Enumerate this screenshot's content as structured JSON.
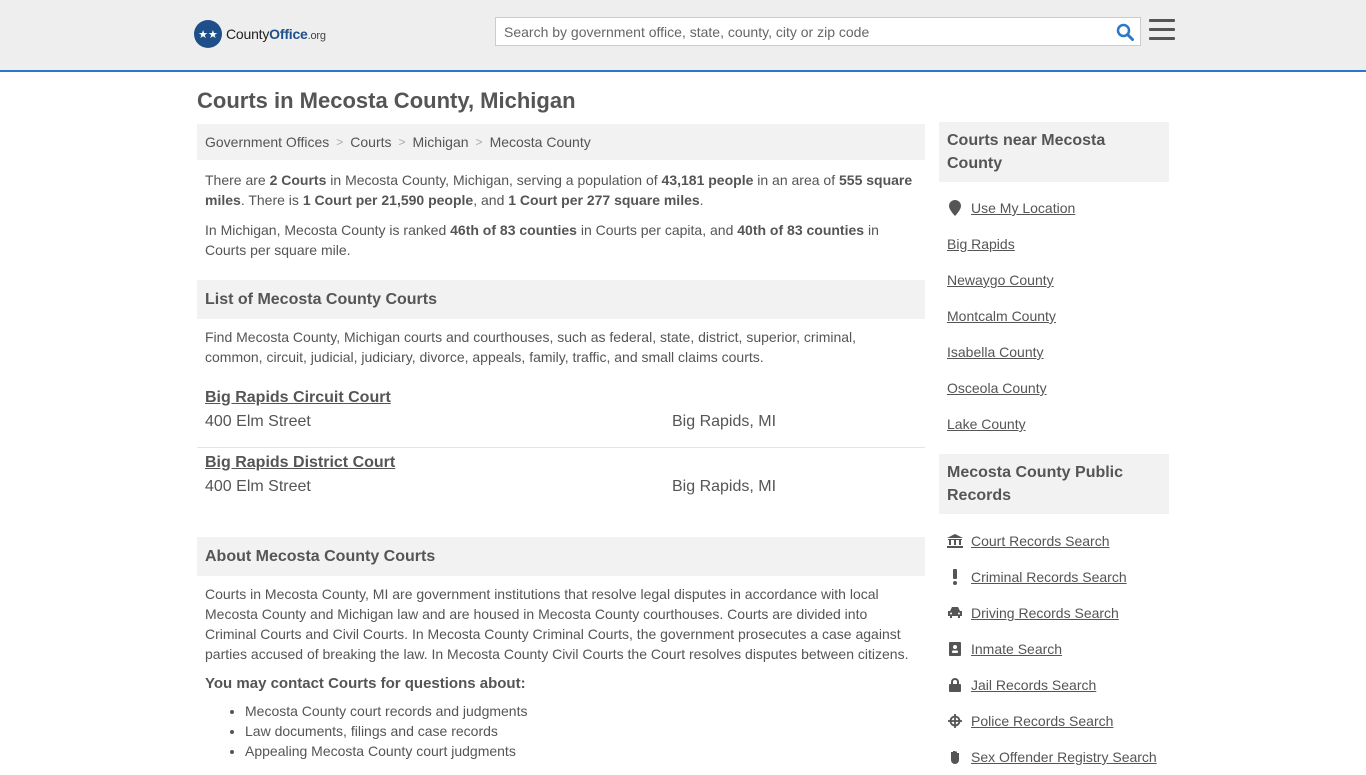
{
  "header": {
    "logo_main": "County",
    "logo_bold": "Office",
    "logo_org": ".org",
    "search_placeholder": "Search by government office, state, county, city or zip code"
  },
  "page_title": "Courts in Mecosta County, Michigan",
  "breadcrumb": [
    "Government Offices",
    "Courts",
    "Michigan",
    "Mecosta County"
  ],
  "intro": {
    "p1": {
      "t1": "There are ",
      "b1": "2 Courts",
      "t2": " in Mecosta County, Michigan, serving a population of ",
      "b2": "43,181 people",
      "t3": " in an area of ",
      "b3": "555 square miles",
      "t4": ". There is ",
      "b4": "1 Court per 21,590 people",
      "t5": ", and ",
      "b5": "1 Court per 277 square miles",
      "t6": "."
    },
    "p2": {
      "t1": "In Michigan, Mecosta County is ranked ",
      "b1": "46th of 83 counties",
      "t2": " in Courts per capita, and ",
      "b2": "40th of 83 counties",
      "t3": " in Courts per square mile."
    }
  },
  "list_section": {
    "title": "List of Mecosta County Courts",
    "description": "Find Mecosta County, Michigan courts and courthouses, such as federal, state, district, superior, criminal, common, circuit, judicial, judiciary, divorce, appeals, family, traffic, and small claims courts.",
    "courts": [
      {
        "name": "Big Rapids Circuit Court",
        "address": "400 Elm Street",
        "city": "Big Rapids, MI"
      },
      {
        "name": "Big Rapids District Court",
        "address": "400 Elm Street",
        "city": "Big Rapids, MI"
      }
    ]
  },
  "about_section": {
    "title": "About Mecosta County Courts",
    "text": "Courts in Mecosta County, MI are government institutions that resolve legal disputes in accordance with local Mecosta County and Michigan law and are housed in Mecosta County courthouses. Courts are divided into Criminal Courts and Civil Courts. In Mecosta County Criminal Courts, the government prosecutes a case against parties accused of breaking the law. In Mecosta County Civil Courts the Court resolves disputes between citizens.",
    "contact_title": "You may contact Courts for questions about:",
    "topics": [
      "Mecosta County court records and judgments",
      "Law documents, filings and case records",
      "Appealing Mecosta County court judgments"
    ]
  },
  "sidebar": {
    "nearby_title": "Courts near Mecosta County",
    "use_location": "Use My Location",
    "nearby": [
      "Big Rapids",
      "Newaygo County",
      "Montcalm County",
      "Isabella County",
      "Osceola County",
      "Lake County"
    ],
    "records_title": "Mecosta County Public Records",
    "records": [
      {
        "label": "Court Records Search",
        "icon": "courthouse-icon"
      },
      {
        "label": "Criminal Records Search",
        "icon": "exclamation-icon"
      },
      {
        "label": "Driving Records Search",
        "icon": "car-icon"
      },
      {
        "label": "Inmate Search",
        "icon": "id-badge-icon"
      },
      {
        "label": "Jail Records Search",
        "icon": "lock-icon"
      },
      {
        "label": "Police Records Search",
        "icon": "crosshair-icon"
      },
      {
        "label": "Sex Offender Registry Search",
        "icon": "hand-icon"
      }
    ]
  }
}
